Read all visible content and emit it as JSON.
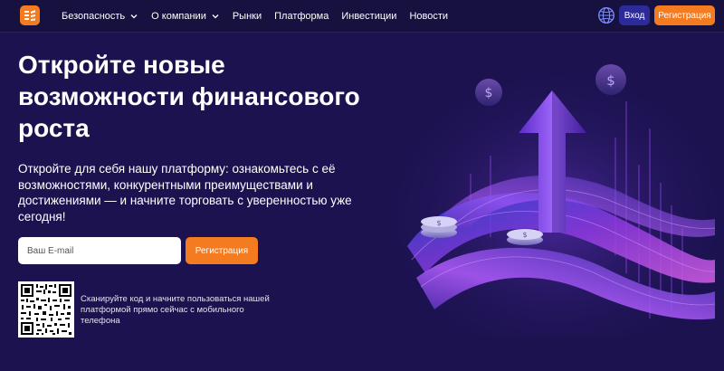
{
  "header": {
    "nav": [
      {
        "label": "Безопасность",
        "has_dropdown": true
      },
      {
        "label": "О компании",
        "has_dropdown": true
      },
      {
        "label": "Рынки",
        "has_dropdown": false
      },
      {
        "label": "Платформа",
        "has_dropdown": false
      },
      {
        "label": "Инвестиции",
        "has_dropdown": false
      },
      {
        "label": "Новости",
        "has_dropdown": false
      }
    ],
    "icons": {
      "language": "globe-icon",
      "logo": "brand-logo"
    },
    "login_label": "Вход",
    "register_label": "Регистрация"
  },
  "hero": {
    "title": "Откройте новые возможности финансового роста",
    "description": "Откройте для себя нашу платформу: ознакомьтесь с её возможностями, конкурентными преимуществами и достижениями — и начните торговать с уверенностью уже сегодня!",
    "email_placeholder": "Ваш E-mail",
    "register_label": "Регистрация",
    "qr_text": "Сканируйте код и начните пользоваться нашей платформой прямо сейчас с мобильного телефона"
  },
  "colors": {
    "background": "#1c1250",
    "topbar": "#16113f",
    "accent_orange": "#f47b20",
    "login_blue": "#2d2a9a"
  }
}
